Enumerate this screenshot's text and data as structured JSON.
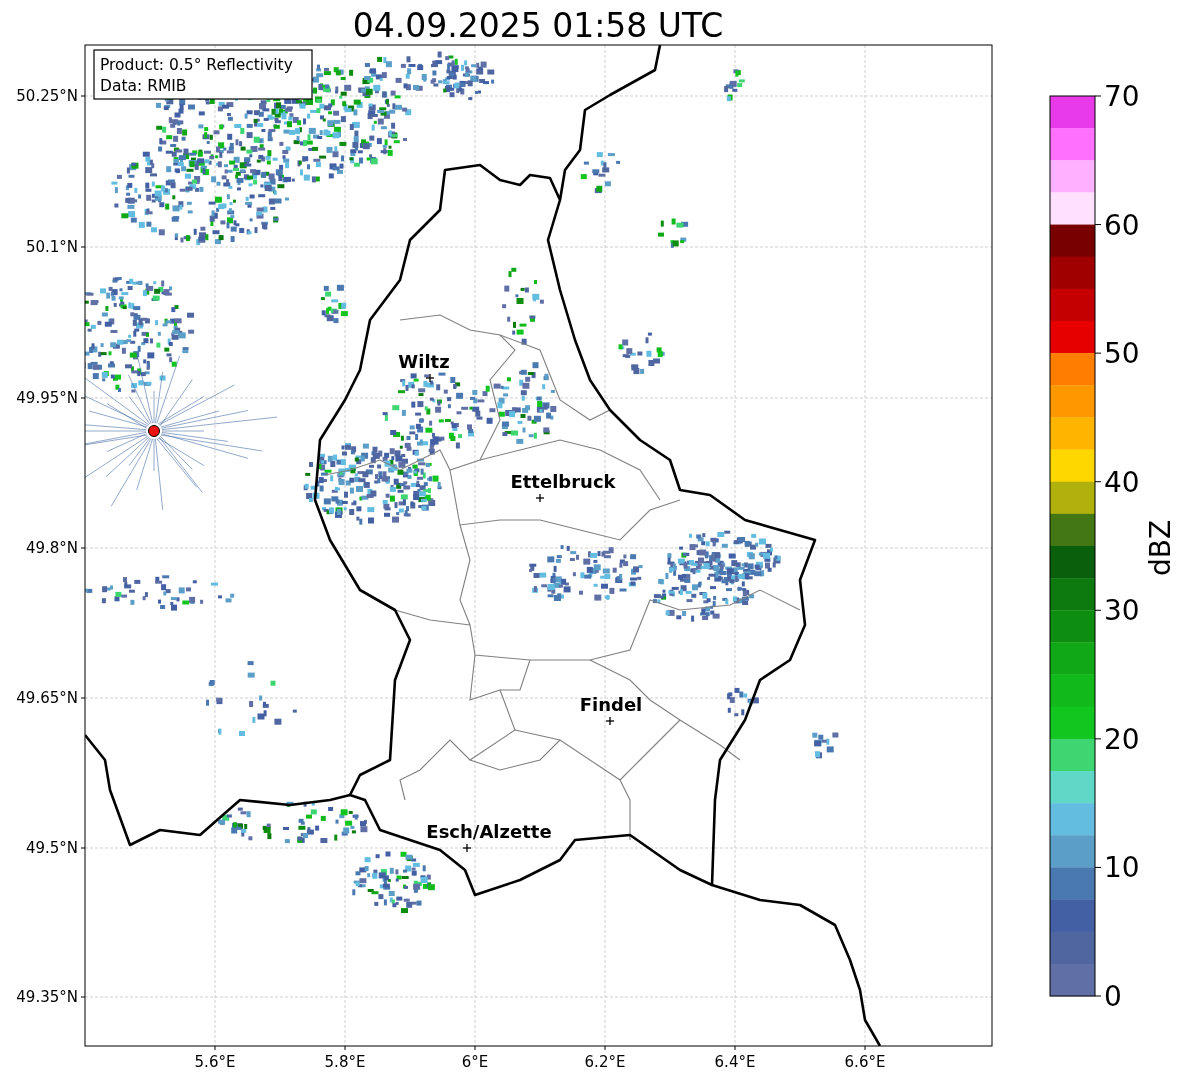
{
  "title": "04.09.2025 01:58 UTC",
  "legend": [
    "Product: 0.5° Reflectivity",
    "Data: RMIB"
  ],
  "map": {
    "lat_labels": [
      "50.25°N",
      "50.1°N",
      "49.95°N",
      "49.8°N",
      "49.65°N",
      "49.5°N",
      "49.35°N"
    ],
    "lon_labels": [
      "5.6°E",
      "5.8°E",
      "6°E",
      "6.2°E",
      "6.4°E",
      "6.6°E"
    ],
    "cities": [
      {
        "name": "Wiltz"
      },
      {
        "name": "Ettelbruck"
      },
      {
        "name": "Findel"
      },
      {
        "name": "Esch/Alzette"
      }
    ]
  },
  "colorbar": {
    "label": "dBZ",
    "ticks": [
      "70",
      "60",
      "50",
      "40",
      "30",
      "20",
      "10",
      "0"
    ],
    "bins": [
      {
        "color": "#e83ae8"
      },
      {
        "color": "#ff70ff"
      },
      {
        "color": "#ffb0ff"
      },
      {
        "color": "#ffe0ff"
      },
      {
        "color": "#780000"
      },
      {
        "color": "#a00000"
      },
      {
        "color": "#c40000"
      },
      {
        "color": "#e60000"
      },
      {
        "color": "#ff7d00"
      },
      {
        "color": "#ff9800"
      },
      {
        "color": "#ffb400"
      },
      {
        "color": "#ffd700"
      },
      {
        "color": "#b0b10c"
      },
      {
        "color": "#437713"
      },
      {
        "color": "#0a5f0c"
      },
      {
        "color": "#0c7a0e"
      },
      {
        "color": "#0e8e10"
      },
      {
        "color": "#10a816"
      },
      {
        "color": "#11b91a"
      },
      {
        "color": "#12c620"
      },
      {
        "color": "#3dd670"
      },
      {
        "color": "#5fd8c8"
      },
      {
        "color": "#63bde0"
      },
      {
        "color": "#5b9ec8"
      },
      {
        "color": "#4a78b0"
      },
      {
        "color": "#4460a4"
      },
      {
        "color": "#4f66a0"
      },
      {
        "color": "#6070a6"
      }
    ]
  }
}
